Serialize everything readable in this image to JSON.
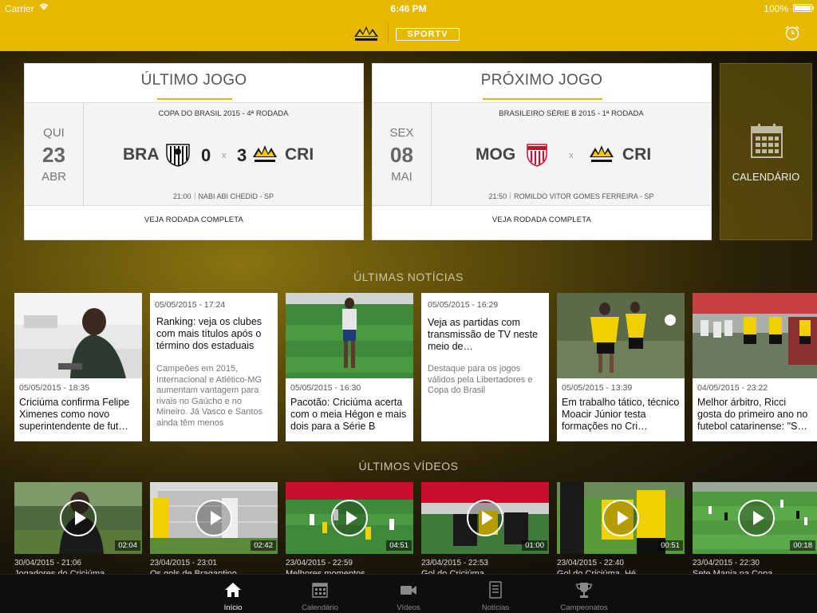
{
  "status_bar": {
    "carrier": "Carrier",
    "time": "6:46 PM",
    "battery": "100%"
  },
  "header": {
    "sportv_logo": "SPORTV"
  },
  "last_match": {
    "title": "ÚLTIMO JOGO",
    "dow": "QUI",
    "day": "23",
    "month": "ABR",
    "competition": "COPA DO BRASIL 2015 - 4ª RODADA",
    "home": "BRA",
    "home_score": "0",
    "x": "x",
    "away_score": "3",
    "away": "CRI",
    "time": "21:00",
    "venue": "NABI ABI CHEDID - SP",
    "link": "VEJA RODADA COMPLETA"
  },
  "next_match": {
    "title": "PRÓXIMO JOGO",
    "dow": "SEX",
    "day": "08",
    "month": "MAI",
    "competition": "BRASILEIRO SÉRIE B 2015 - 1ª RODADA",
    "home": "MOG",
    "x": "x",
    "away": "CRI",
    "time": "21:50",
    "venue": "ROMILDO VITOR GOMES FERREIRA - SP",
    "link": "VEJA RODADA COMPLETA"
  },
  "calendar_button": {
    "label": "CALENDÁRIO",
    "icon": "calendar-icon"
  },
  "news_section": {
    "title": "ÚLTIMAS NOTÍCIAS",
    "items": [
      {
        "date": "05/05/2015 - 18:35",
        "title": "Criciúma confirma Felipe Ximenes como novo superintendente de fut…"
      },
      {
        "date": "05/05/2015 - 17:24",
        "title": "Ranking: veja os clubes com mais títulos após o término dos estaduais",
        "summary": "Campeões em 2015, Internacional e Atlético-MG aumentam vantagem para rivais no Gaúcho e no Mineiro. Já Vasco e Santos ainda têm menos"
      },
      {
        "date": "05/05/2015 - 16:30",
        "title": "Pacotão: Criciúma acerta com o meia Hégon e mais dois para a Série B"
      },
      {
        "date": "05/05/2015 - 16:29",
        "title": "Veja as partidas com transmissão de TV neste meio de…",
        "summary": "Destaque para os jogos válidos pela Libertadores e Copa do Brasil"
      },
      {
        "date": "05/05/2015 - 13:39",
        "title": "Em trabalho tático, técnico Moacir Júnior testa formações no Cri…"
      },
      {
        "date": "04/05/2015 - 23:22",
        "title": "Melhor árbitro, Ricci gosta do primeiro ano no futebol catarinense: \"S…"
      }
    ]
  },
  "videos_section": {
    "title": "ÚLTIMOS VÍDEOS",
    "items": [
      {
        "duration": "02:04",
        "date": "30/04/2015 - 21:06",
        "title": "Jogadores do Criciúma"
      },
      {
        "duration": "02:42",
        "date": "23/04/2015 - 23:01",
        "title": "Os gols de Bragantino"
      },
      {
        "duration": "04:51",
        "date": "23/04/2015 - 22:59",
        "title": "Melhores momentos"
      },
      {
        "duration": "01:00",
        "date": "23/04/2015 - 22:53",
        "title": "Gol do Criciúma"
      },
      {
        "duration": "00:51",
        "date": "23/04/2015 - 22:40",
        "title": "Gol do Criciúma, Hé"
      },
      {
        "duration": "00:18",
        "date": "23/04/2015 - 22:30",
        "title": "Sete Mania na Copa"
      }
    ]
  },
  "tab_bar": [
    {
      "label": "Início",
      "icon": "home-icon",
      "active": true
    },
    {
      "label": "Calendário",
      "icon": "calendar-icon"
    },
    {
      "label": "Vídeos",
      "icon": "video-camera-icon"
    },
    {
      "label": "Notícias",
      "icon": "news-icon"
    },
    {
      "label": "Campeonatos",
      "icon": "trophy-icon"
    }
  ],
  "colors": {
    "header": "#e6b800",
    "accent": "#e6b800",
    "tabbar": "#0e0e0e"
  }
}
